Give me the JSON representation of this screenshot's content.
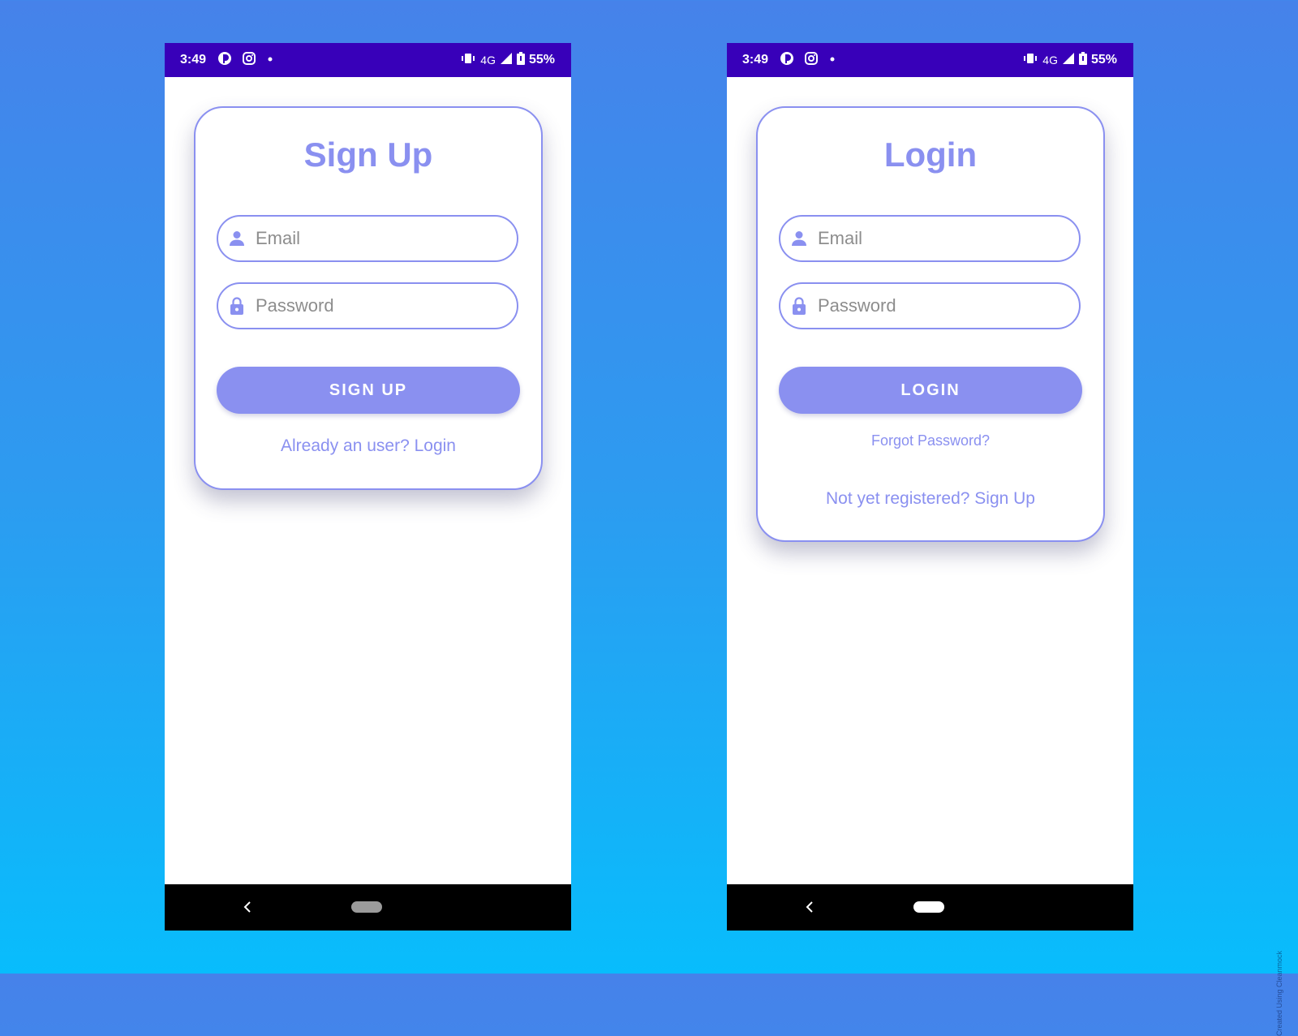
{
  "status_bar": {
    "time": "3:49",
    "network": "4G",
    "battery": "55%",
    "icons": [
      "app-icon",
      "instagram-icon",
      "notification-dot-icon",
      "vibrate-icon",
      "signal-icon",
      "battery-icon"
    ]
  },
  "signup_screen": {
    "title": "Sign Up",
    "email_placeholder": "Email",
    "password_placeholder": "Password",
    "button_label": "SIGN UP",
    "login_link": "Already an user? Login"
  },
  "login_screen": {
    "title": "Login",
    "email_placeholder": "Email",
    "password_placeholder": "Password",
    "button_label": "LOGIN",
    "forgot_link": "Forgot Password?",
    "signup_link": "Not yet registered? Sign Up"
  },
  "watermark": "Created Using Cleanmock",
  "colors": {
    "accent": "#8a90f0",
    "status_bar": "#3800b9",
    "background_top": "#4682ea",
    "background_bottom": "#08bdfc"
  }
}
